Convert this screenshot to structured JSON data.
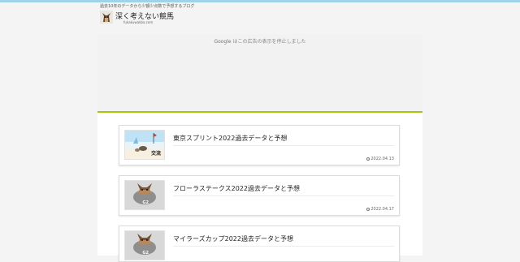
{
  "header": {
    "tagline": "過去10年のデータから少額少点数で予想するブログ",
    "site_title": "深く考えない競馬",
    "site_domain": "fukakuwakba.com"
  },
  "ad": {
    "brand": "Google",
    "message": "はこの広告の表示を停止しました"
  },
  "posts": [
    {
      "title": "東京スプリント2022過去データと予想",
      "date": "2022.04.13",
      "thumb_label": "交流"
    },
    {
      "title": "フローラステークス2022過去データと予想",
      "date": "2022.04.17",
      "thumb_label": "G2"
    },
    {
      "title": "マイラーズカップ2022過去データと予想",
      "date": "",
      "thumb_label": "G2"
    }
  ]
}
